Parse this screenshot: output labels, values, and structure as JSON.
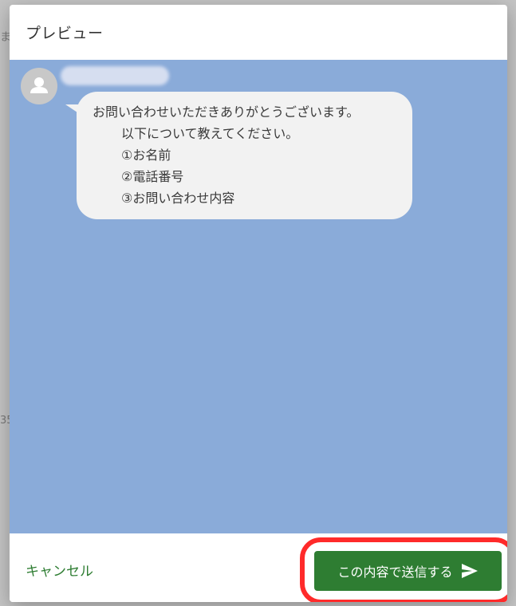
{
  "background": {
    "fragment_1": "ま",
    "fragment_2": "35"
  },
  "dialog": {
    "title": "プレビュー"
  },
  "preview": {
    "background_color": "#8aabd9",
    "message_lines": [
      "お問い合わせいただきありがとうございます。",
      "以下について教えてください。",
      "①お名前",
      "②電話番号",
      "③お問い合わせ内容"
    ]
  },
  "footer": {
    "cancel_label": "キャンセル",
    "send_label": "この内容で送信する",
    "send_icon": "send-icon",
    "accent_color": "#2e7d32",
    "highlight_color": "#ff2a2a"
  }
}
